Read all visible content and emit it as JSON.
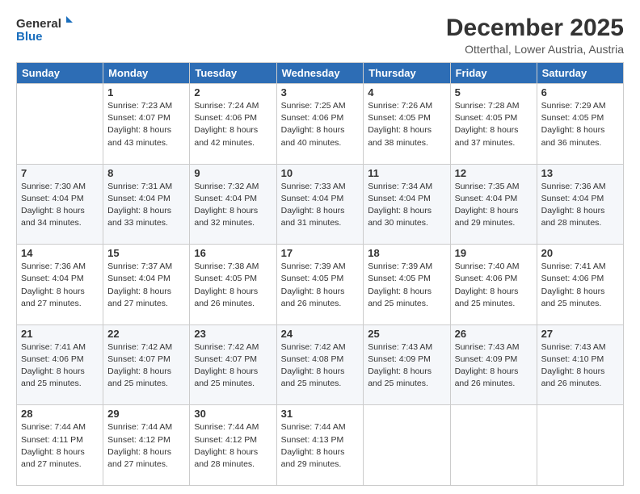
{
  "logo": {
    "line1": "General",
    "line2": "Blue"
  },
  "header": {
    "title": "December 2025",
    "subtitle": "Otterthal, Lower Austria, Austria"
  },
  "days_of_week": [
    "Sunday",
    "Monday",
    "Tuesday",
    "Wednesday",
    "Thursday",
    "Friday",
    "Saturday"
  ],
  "weeks": [
    [
      {
        "day": "",
        "info": ""
      },
      {
        "day": "1",
        "info": "Sunrise: 7:23 AM\nSunset: 4:07 PM\nDaylight: 8 hours\nand 43 minutes."
      },
      {
        "day": "2",
        "info": "Sunrise: 7:24 AM\nSunset: 4:06 PM\nDaylight: 8 hours\nand 42 minutes."
      },
      {
        "day": "3",
        "info": "Sunrise: 7:25 AM\nSunset: 4:06 PM\nDaylight: 8 hours\nand 40 minutes."
      },
      {
        "day": "4",
        "info": "Sunrise: 7:26 AM\nSunset: 4:05 PM\nDaylight: 8 hours\nand 38 minutes."
      },
      {
        "day": "5",
        "info": "Sunrise: 7:28 AM\nSunset: 4:05 PM\nDaylight: 8 hours\nand 37 minutes."
      },
      {
        "day": "6",
        "info": "Sunrise: 7:29 AM\nSunset: 4:05 PM\nDaylight: 8 hours\nand 36 minutes."
      }
    ],
    [
      {
        "day": "7",
        "info": "Sunrise: 7:30 AM\nSunset: 4:04 PM\nDaylight: 8 hours\nand 34 minutes."
      },
      {
        "day": "8",
        "info": "Sunrise: 7:31 AM\nSunset: 4:04 PM\nDaylight: 8 hours\nand 33 minutes."
      },
      {
        "day": "9",
        "info": "Sunrise: 7:32 AM\nSunset: 4:04 PM\nDaylight: 8 hours\nand 32 minutes."
      },
      {
        "day": "10",
        "info": "Sunrise: 7:33 AM\nSunset: 4:04 PM\nDaylight: 8 hours\nand 31 minutes."
      },
      {
        "day": "11",
        "info": "Sunrise: 7:34 AM\nSunset: 4:04 PM\nDaylight: 8 hours\nand 30 minutes."
      },
      {
        "day": "12",
        "info": "Sunrise: 7:35 AM\nSunset: 4:04 PM\nDaylight: 8 hours\nand 29 minutes."
      },
      {
        "day": "13",
        "info": "Sunrise: 7:36 AM\nSunset: 4:04 PM\nDaylight: 8 hours\nand 28 minutes."
      }
    ],
    [
      {
        "day": "14",
        "info": "Sunrise: 7:36 AM\nSunset: 4:04 PM\nDaylight: 8 hours\nand 27 minutes."
      },
      {
        "day": "15",
        "info": "Sunrise: 7:37 AM\nSunset: 4:04 PM\nDaylight: 8 hours\nand 27 minutes."
      },
      {
        "day": "16",
        "info": "Sunrise: 7:38 AM\nSunset: 4:05 PM\nDaylight: 8 hours\nand 26 minutes."
      },
      {
        "day": "17",
        "info": "Sunrise: 7:39 AM\nSunset: 4:05 PM\nDaylight: 8 hours\nand 26 minutes."
      },
      {
        "day": "18",
        "info": "Sunrise: 7:39 AM\nSunset: 4:05 PM\nDaylight: 8 hours\nand 25 minutes."
      },
      {
        "day": "19",
        "info": "Sunrise: 7:40 AM\nSunset: 4:06 PM\nDaylight: 8 hours\nand 25 minutes."
      },
      {
        "day": "20",
        "info": "Sunrise: 7:41 AM\nSunset: 4:06 PM\nDaylight: 8 hours\nand 25 minutes."
      }
    ],
    [
      {
        "day": "21",
        "info": "Sunrise: 7:41 AM\nSunset: 4:06 PM\nDaylight: 8 hours\nand 25 minutes."
      },
      {
        "day": "22",
        "info": "Sunrise: 7:42 AM\nSunset: 4:07 PM\nDaylight: 8 hours\nand 25 minutes."
      },
      {
        "day": "23",
        "info": "Sunrise: 7:42 AM\nSunset: 4:07 PM\nDaylight: 8 hours\nand 25 minutes."
      },
      {
        "day": "24",
        "info": "Sunrise: 7:42 AM\nSunset: 4:08 PM\nDaylight: 8 hours\nand 25 minutes."
      },
      {
        "day": "25",
        "info": "Sunrise: 7:43 AM\nSunset: 4:09 PM\nDaylight: 8 hours\nand 25 minutes."
      },
      {
        "day": "26",
        "info": "Sunrise: 7:43 AM\nSunset: 4:09 PM\nDaylight: 8 hours\nand 26 minutes."
      },
      {
        "day": "27",
        "info": "Sunrise: 7:43 AM\nSunset: 4:10 PM\nDaylight: 8 hours\nand 26 minutes."
      }
    ],
    [
      {
        "day": "28",
        "info": "Sunrise: 7:44 AM\nSunset: 4:11 PM\nDaylight: 8 hours\nand 27 minutes."
      },
      {
        "day": "29",
        "info": "Sunrise: 7:44 AM\nSunset: 4:12 PM\nDaylight: 8 hours\nand 27 minutes."
      },
      {
        "day": "30",
        "info": "Sunrise: 7:44 AM\nSunset: 4:12 PM\nDaylight: 8 hours\nand 28 minutes."
      },
      {
        "day": "31",
        "info": "Sunrise: 7:44 AM\nSunset: 4:13 PM\nDaylight: 8 hours\nand 29 minutes."
      },
      {
        "day": "",
        "info": ""
      },
      {
        "day": "",
        "info": ""
      },
      {
        "day": "",
        "info": ""
      }
    ]
  ]
}
